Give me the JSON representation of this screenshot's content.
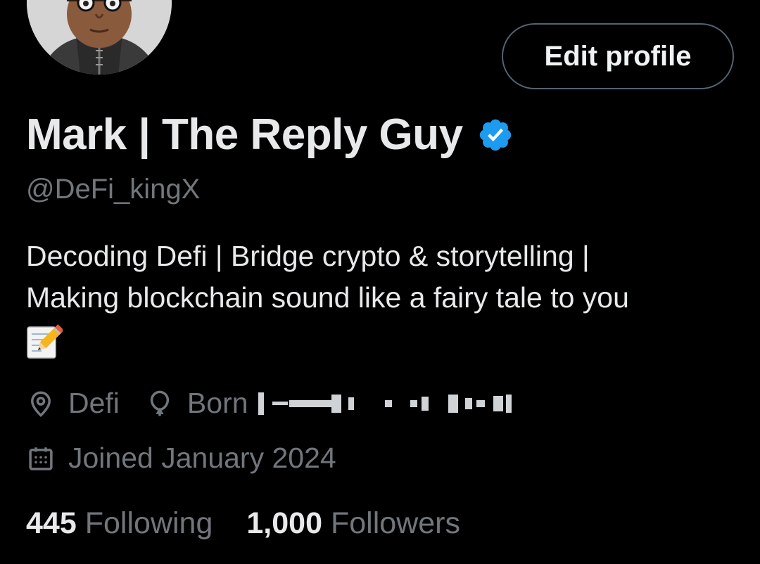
{
  "profile": {
    "display_name": "Mark | The Reply Guy",
    "handle": "@DeFi_kingX",
    "verified": true,
    "bio_line1": "Decoding Defi | Bridge crypto & storytelling |",
    "bio_line2": "Making blockchain sound like a fairy tale to you",
    "bio_emoji": "memo-icon"
  },
  "actions": {
    "edit_profile_label": "Edit profile"
  },
  "meta": {
    "location": "Defi",
    "born_label": "Born",
    "joined": "Joined January 2024"
  },
  "stats": {
    "following_count": "445",
    "following_label": "Following",
    "followers_count": "1,000",
    "followers_label": "Followers"
  },
  "colors": {
    "background": "#000000",
    "primary_text": "#e7e9ea",
    "secondary_text": "#71767b",
    "verified_blue": "#1d9bf0",
    "button_border": "#536471"
  }
}
